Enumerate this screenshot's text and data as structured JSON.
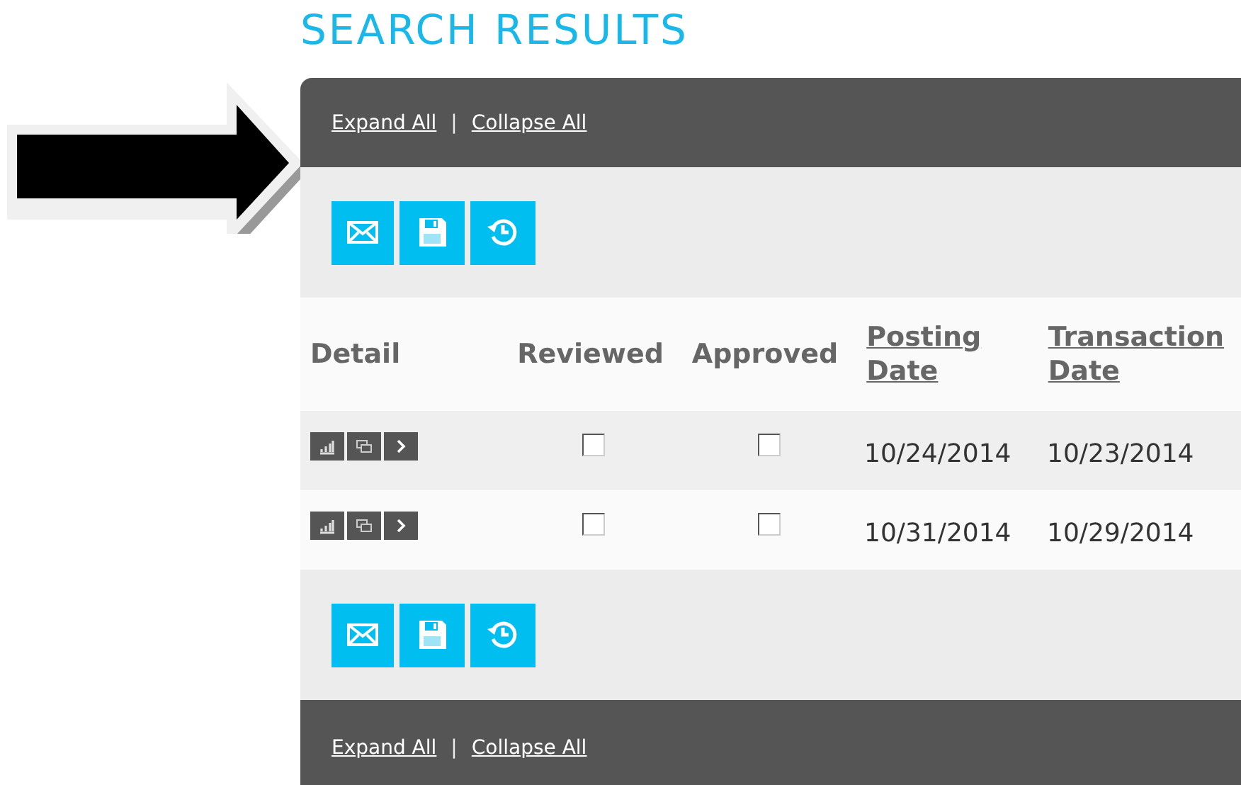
{
  "title": "SEARCH RESULTS",
  "header_bar": {
    "links": [
      {
        "label": "Expand All"
      },
      {
        "label": "Collapse All"
      }
    ],
    "separator": "|"
  },
  "table": {
    "columns": [
      {
        "label": "Detail",
        "sortable": false
      },
      {
        "label": "Reviewed",
        "sortable": false
      },
      {
        "label": "Approved",
        "sortable": false
      },
      {
        "label": "Posting Date",
        "sortable": true
      },
      {
        "label": "Transaction Date",
        "sortable": true
      }
    ],
    "rows": [
      {
        "reviewed": false,
        "approved": false,
        "posting_date": "10/24/2014",
        "transaction_date": "10/23/2014"
      },
      {
        "reviewed": false,
        "approved": false,
        "posting_date": "10/31/2014",
        "transaction_date": "10/29/2014"
      }
    ]
  },
  "footer_bar": {
    "links": [
      {
        "label": "Expand All"
      },
      {
        "label": "Collapse All"
      }
    ],
    "separator": "|"
  }
}
